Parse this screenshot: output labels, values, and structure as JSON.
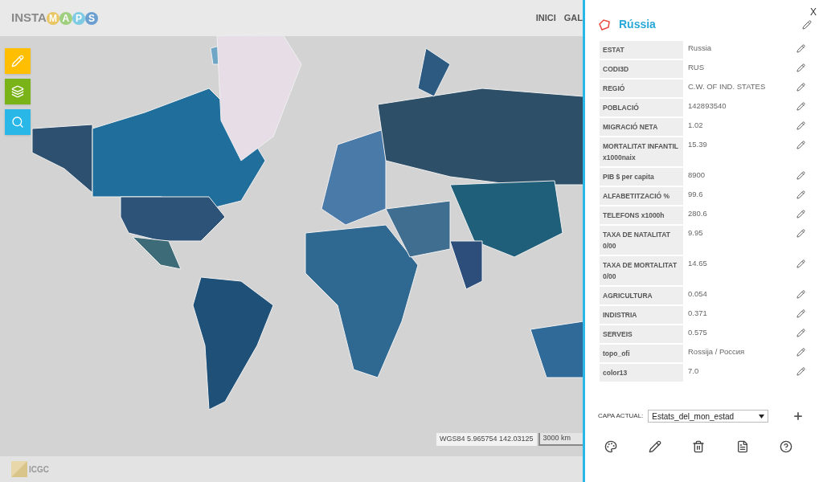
{
  "header": {
    "logo": {
      "prefix": "INSTA",
      "letters": [
        {
          "text": "M",
          "color": "#e9c564"
        },
        {
          "text": "A",
          "color": "#9fcf7f"
        },
        {
          "text": "P",
          "color": "#7fcbe4"
        },
        {
          "text": "S",
          "color": "#6a9fd0"
        }
      ]
    },
    "nav": [
      "INICI",
      "GAL"
    ]
  },
  "map": {
    "coordinates": "WGS84 5.965754 142.03125",
    "scale": "3000 km",
    "footer_logo": "ICGC"
  },
  "panel": {
    "close": "X",
    "title": "Rússia",
    "rows": [
      {
        "label": "ESTAT",
        "value": "Russia"
      },
      {
        "label": "CODI3D",
        "value": "RUS"
      },
      {
        "label": "REGIÓ",
        "value": "C.W. OF IND. STATES"
      },
      {
        "label": "POBLACIÓ",
        "value": "142893540"
      },
      {
        "label": "MIGRACIÓ NETA",
        "value": "1.02"
      },
      {
        "label": "MORTALITAT INFANTIL x1000naix",
        "value": "15.39"
      },
      {
        "label": "PIB $ per capita",
        "value": "8900"
      },
      {
        "label": "ALFABETITZACIÓ %",
        "value": "99.6"
      },
      {
        "label": "TELEFONS x1000h",
        "value": "280.6"
      },
      {
        "label": "TAXA DE NATALITAT 0/00",
        "value": "9.95"
      },
      {
        "label": "TAXA DE MORTALITAT 0/00",
        "value": "14.65"
      },
      {
        "label": "AGRICULTURA",
        "value": "0.054"
      },
      {
        "label": "INDISTRIA",
        "value": "0.371"
      },
      {
        "label": "SERVEIS",
        "value": "0.575"
      },
      {
        "label": "topo_ofi",
        "value": "Rossija / Россия"
      },
      {
        "label": "color13",
        "value": "7.0"
      }
    ],
    "layer_label": "CAPA ACTUAL:",
    "layer_value": "Estats_del_mon_estad"
  }
}
